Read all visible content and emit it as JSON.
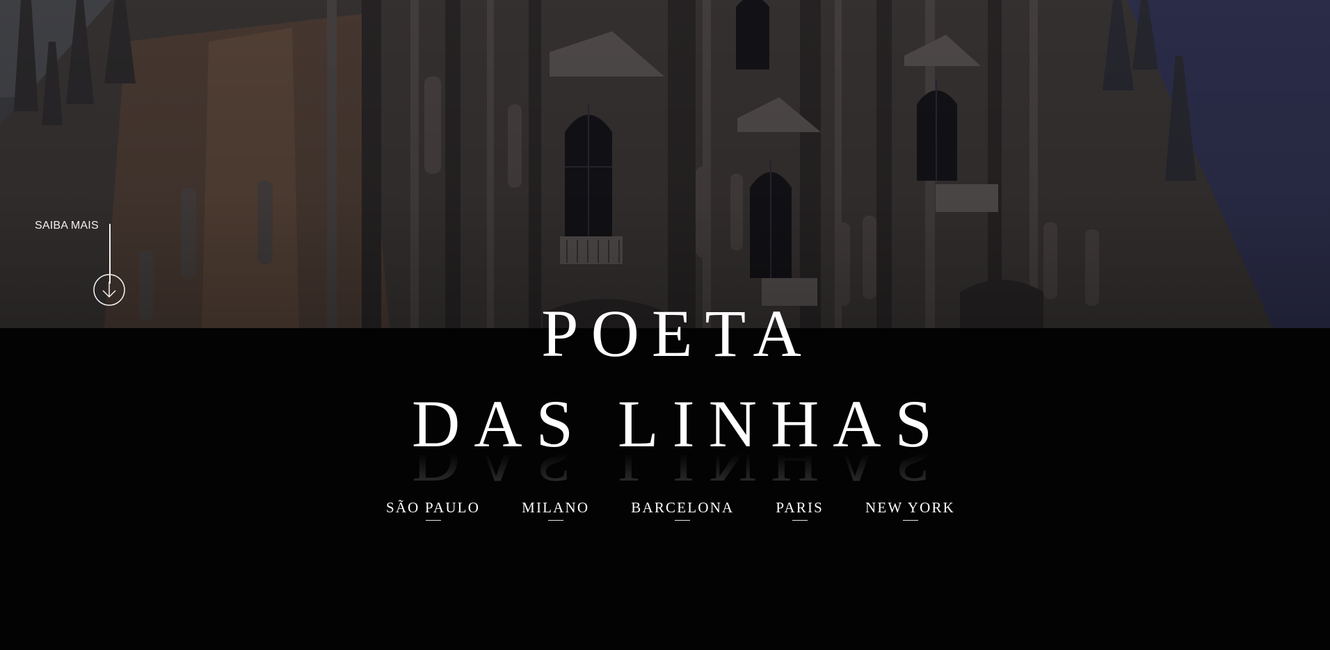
{
  "hero": {
    "image_alt": "cathedral-facade-photo"
  },
  "scroll_cue": {
    "label": "SAIBA MAIS",
    "icon": "arrow-down-circle-icon"
  },
  "title": {
    "line1": "POETA",
    "line2": "DAS LINHAS"
  },
  "cities": [
    {
      "label": "SÃO PAULO"
    },
    {
      "label": "MILANO"
    },
    {
      "label": "BARCELONA"
    },
    {
      "label": "PARIS"
    },
    {
      "label": "NEW YORK"
    }
  ],
  "colors": {
    "background": "#030303",
    "text": "#ffffff"
  }
}
